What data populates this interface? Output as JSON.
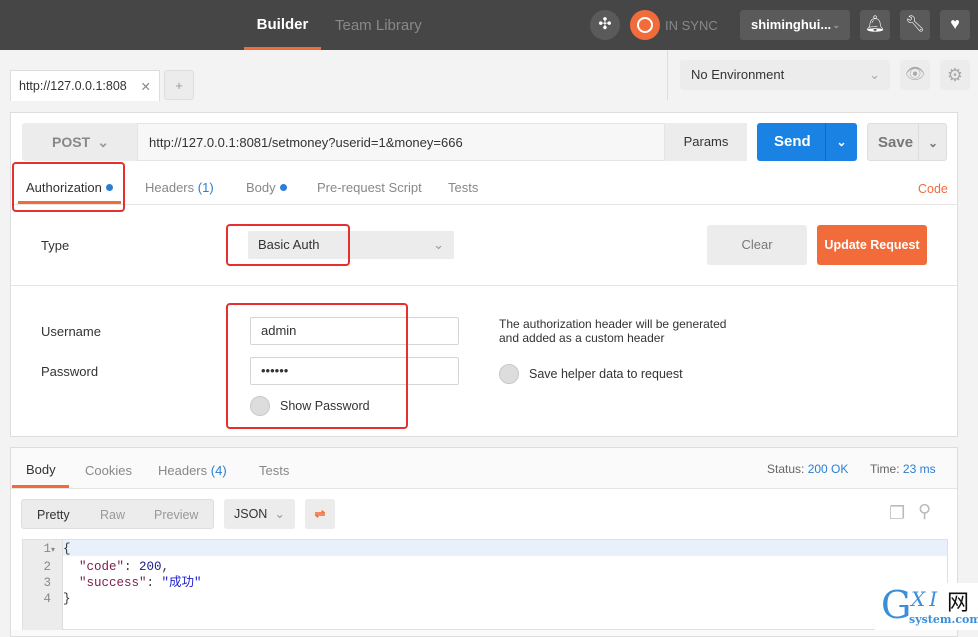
{
  "header": {
    "tabs": [
      "Builder",
      "Team Library"
    ],
    "sync_label": "IN SYNC",
    "user": "shiminghui..."
  },
  "request_tab": {
    "label": "http://127.0.0.1:808",
    "add": "+"
  },
  "environment": {
    "selected": "No Environment"
  },
  "request": {
    "method": "POST",
    "url": "http://127.0.0.1:8081/setmoney?userid=1&money=666",
    "params": "Params",
    "send": "Send",
    "save": "Save"
  },
  "req_tabs": {
    "authorization": "Authorization",
    "headers": "Headers",
    "headers_count": "(1)",
    "body": "Body",
    "prerequest": "Pre-request Script",
    "tests": "Tests",
    "code": "Code"
  },
  "auth": {
    "type_label": "Type",
    "type_value": "Basic Auth",
    "clear": "Clear",
    "update": "Update Request",
    "username_label": "Username",
    "username": "admin",
    "password_label": "Password",
    "password": "••••••",
    "show_password": "Show Password",
    "info": "The authorization header will be generated and added as a custom header",
    "save_helper": "Save helper data to request"
  },
  "response": {
    "tabs": [
      "Body",
      "Cookies",
      "Headers",
      "Tests"
    ],
    "headers_count": "(4)",
    "status_label": "Status:",
    "status": "200 OK",
    "time_label": "Time:",
    "time": "23 ms",
    "views": [
      "Pretty",
      "Raw",
      "Preview"
    ],
    "format": "JSON",
    "lines": [
      {
        "n": "1",
        "t": "{"
      },
      {
        "n": "2",
        "k": "\"code\"",
        "v": "200",
        "p": ","
      },
      {
        "n": "3",
        "k": "\"success\"",
        "s": "\"成功\""
      },
      {
        "n": "4",
        "t": "}"
      }
    ]
  },
  "watermark": {
    "text": "GXI网",
    "sub": "system.com"
  },
  "colors": {
    "accent": "#f26b3a",
    "blue": "#2a7ed3",
    "send": "#1a82e2",
    "annotation": "#e53030"
  }
}
